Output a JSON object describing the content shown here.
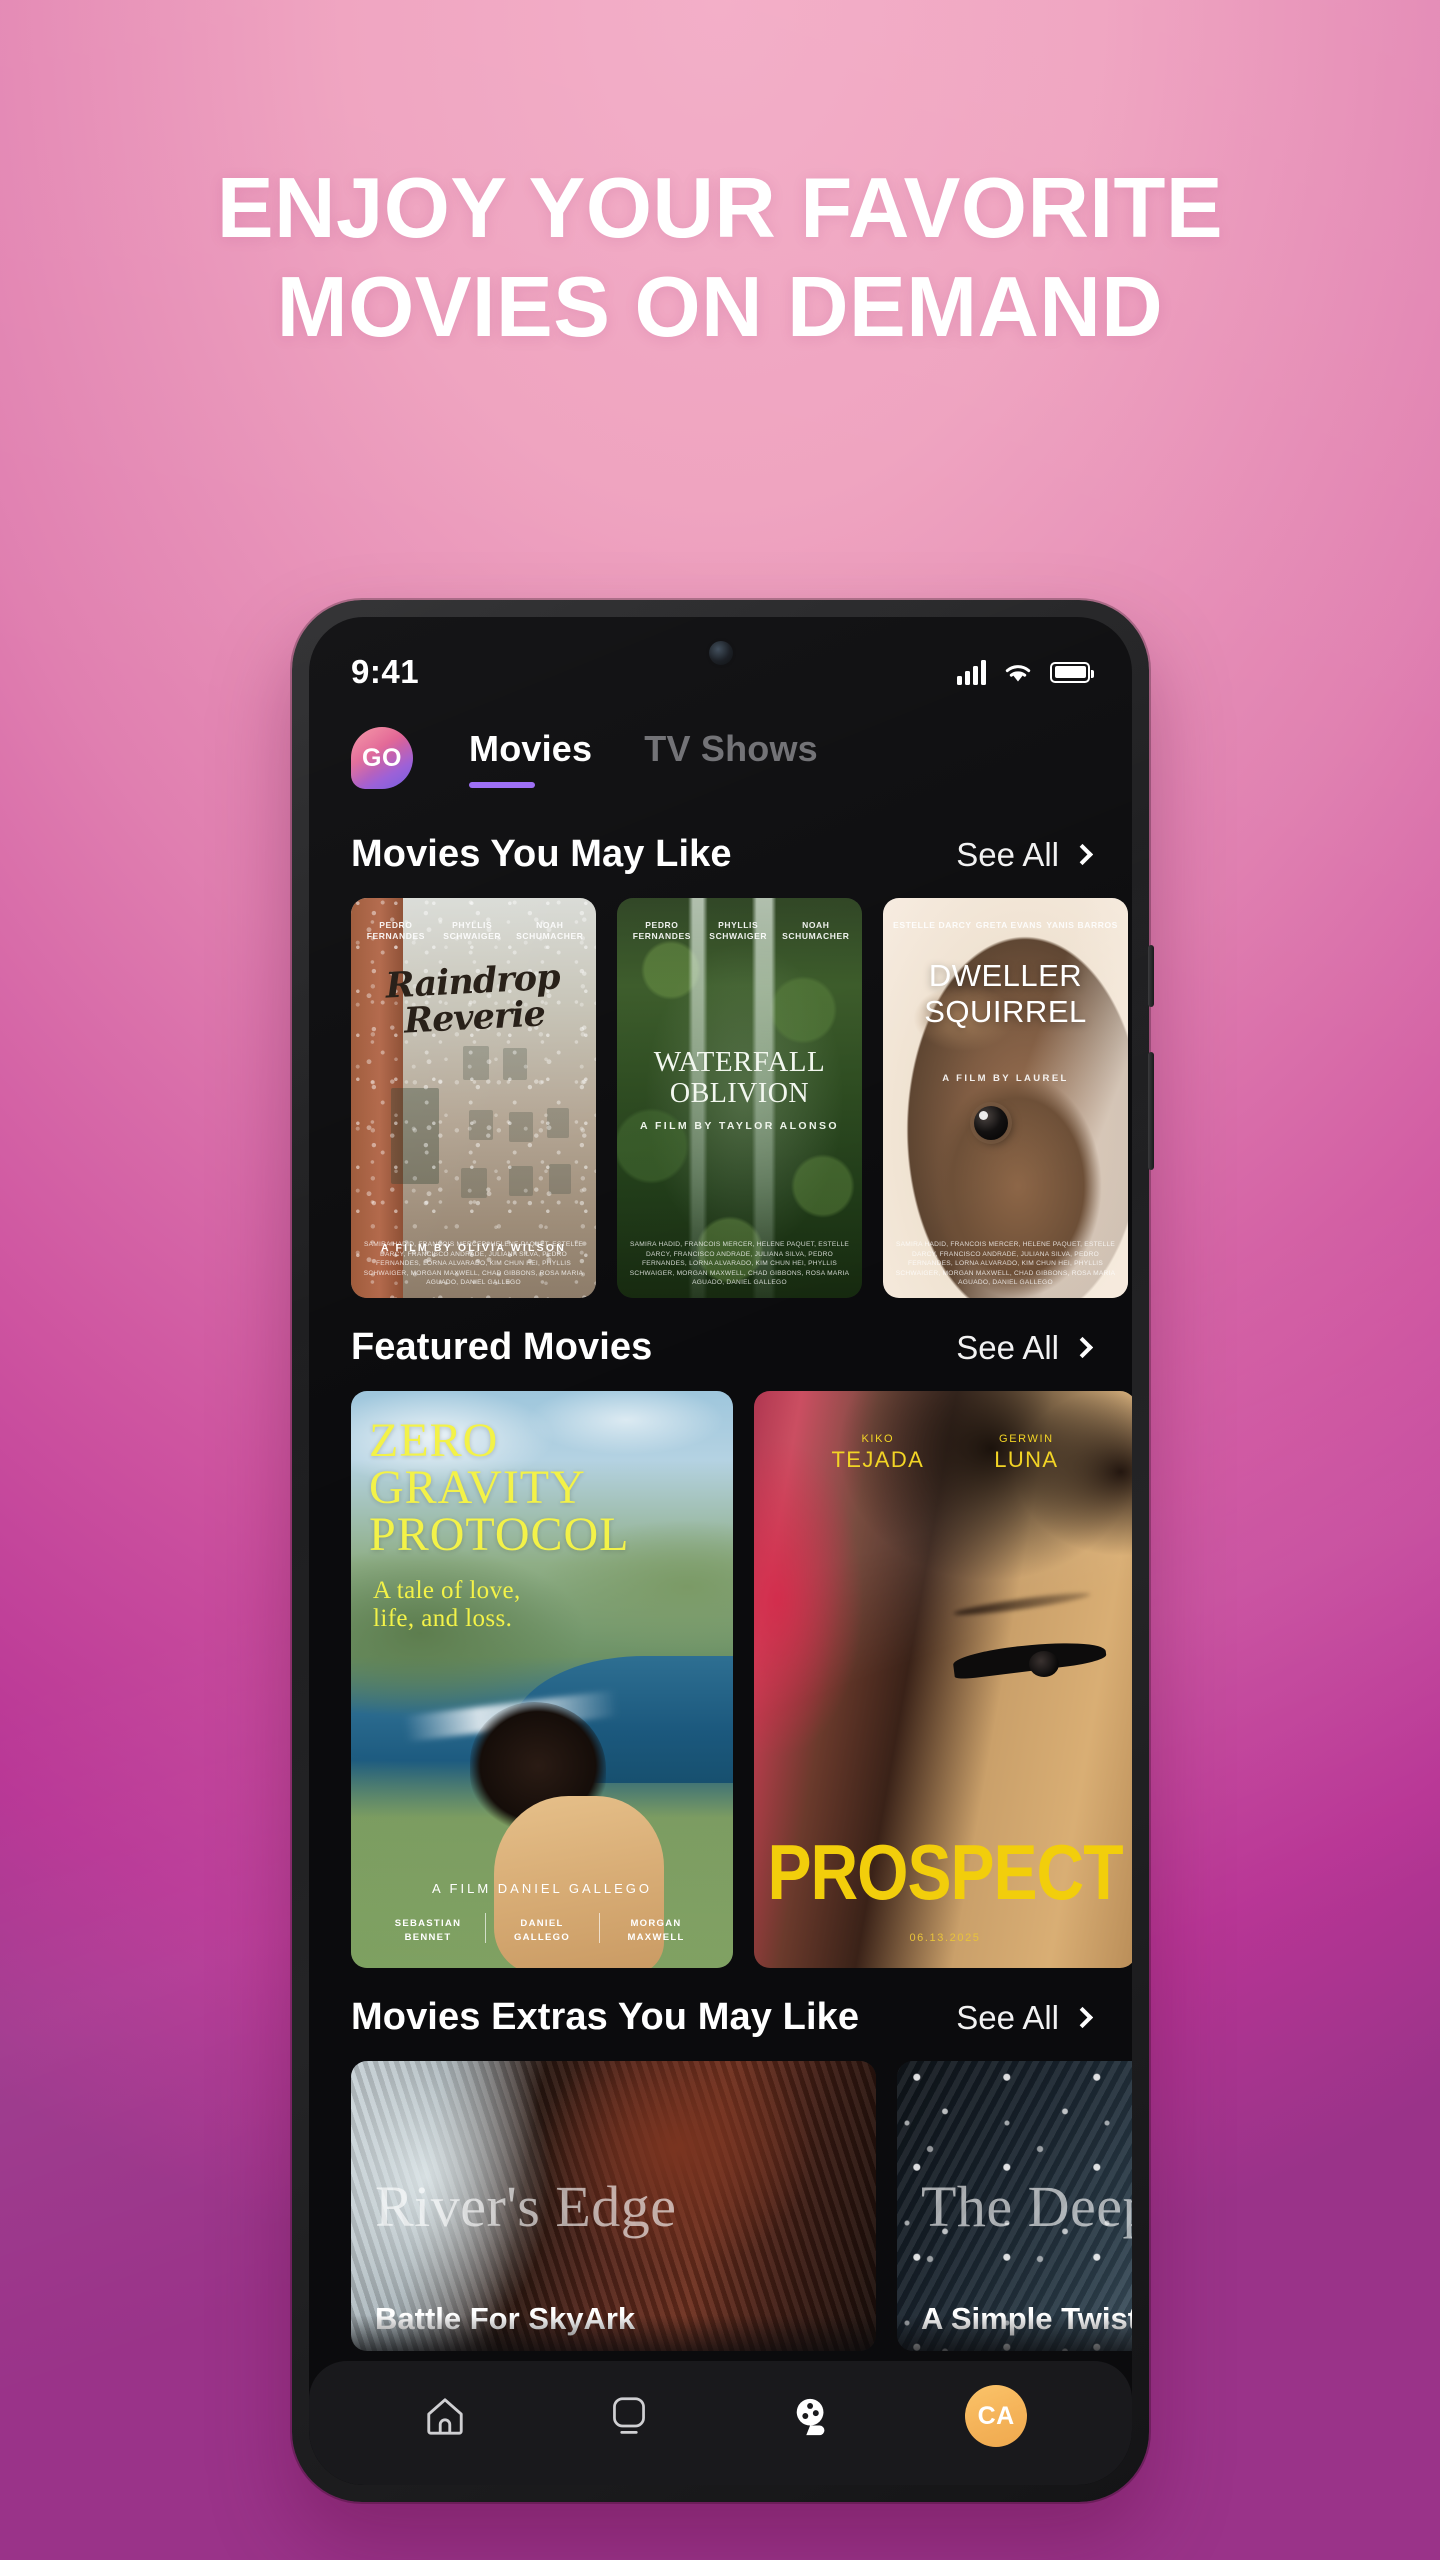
{
  "promo": {
    "headline_line1": "ENJOY YOUR FAVORITE",
    "headline_line2": "MOVIES ON DEMAND",
    "headline_color": "#FFFFFF",
    "background_top_color": "#F0A7C1",
    "background_bottom_left_color": "#C4418F",
    "background_bottom_right_color": "#93338A"
  },
  "status_bar": {
    "time": "9:41",
    "signal_icon": "cellular-signal-icon",
    "wifi_icon": "wifi-icon",
    "battery_icon": "battery-full-icon"
  },
  "app_bar": {
    "logo_text": "GO",
    "tabs": [
      {
        "label": "Movies",
        "active": true
      },
      {
        "label": "TV Shows",
        "active": false
      }
    ],
    "active_indicator_color": "#9B6BF5"
  },
  "sections": [
    {
      "title": "Movies You May Like",
      "see_all_label": "See All",
      "see_all_icon": "chevron-right-icon",
      "items": [
        {
          "title_line1": "Raindrop",
          "title_line2": "Reverie",
          "cast_top": [
            "PEDRO FERNANDES",
            "PHYLLIS SCHWAIGER",
            "NOAH SCHUMACHER"
          ],
          "director": "A FILM BY OLIVIA WILSON",
          "credits": "SAMIRA HADID, FRANCOIS MERCER, HELENE PAQUET, ESTELLE DARCY, FRANCISCO ANDRADE, JULIANA SILVA, PEDRO FERNANDES, LORNA ALVARADO, KIM CHUN HEI, PHYLLIS SCHWAIGER, MORGAN MAXWELL, CHAD GIBBONS, ROSA MARIA AGUADO, DANIEL GALLEGO"
        },
        {
          "title_line1": "WATERFALL",
          "title_line2": "OBLIVION",
          "cast_top": [
            "PEDRO FERNANDES",
            "PHYLLIS SCHWAIGER",
            "NOAH SCHUMACHER"
          ],
          "director": "A FILM BY TAYLOR ALONSO",
          "credits": "SAMIRA HADID, FRANCOIS MERCER, HELENE PAQUET, ESTELLE DARCY, FRANCISCO ANDRADE, JULIANA SILVA, PEDRO FERNANDES, LORNA ALVARADO, KIM CHUN HEI, PHYLLIS SCHWAIGER, MORGAN MAXWELL, CHAD GIBBONS, ROSA MARIA AGUADO, DANIEL GALLEGO"
        },
        {
          "title_line1": "DWELLER",
          "title_line2": "SQUIRREL",
          "cast_top": [
            "ESTELLE DARCY",
            "GRETA EVANS",
            "YANIS BARROS"
          ],
          "director": "A FILM BY LAUREL",
          "credits": "SAMIRA HADID, FRANCOIS MERCER, HELENE PAQUET, ESTELLE DARCY, FRANCISCO ANDRADE, JULIANA SILVA, PEDRO FERNANDES, LORNA ALVARADO, KIM CHUN HEI, PHYLLIS SCHWAIGER, MORGAN MAXWELL, CHAD GIBBONS, ROSA MARIA AGUADO, DANIEL GALLEGO"
        }
      ]
    },
    {
      "title": "Featured Movies",
      "see_all_label": "See All",
      "see_all_icon": "chevron-right-icon",
      "items": [
        {
          "title_line1": "ZERO",
          "title_line2": "GRAVITY",
          "title_line3": "PROTOCOL",
          "tagline_line1": "A tale of love,",
          "tagline_line2": "life, and loss.",
          "director": "A FILM DANIEL GALLEGO",
          "cast": [
            {
              "first": "SEBASTIAN",
              "last": "BENNET"
            },
            {
              "first": "DANIEL",
              "last": "GALLEGO"
            },
            {
              "first": "MORGAN",
              "last": "MAXWELL"
            }
          ],
          "title_color": "#F3F248"
        },
        {
          "title": "PROSPECT",
          "cast": [
            {
              "first": "KIKO",
              "last": "TEJADA"
            },
            {
              "first": "GERWIN",
              "last": "LUNA"
            }
          ],
          "release_date": "06.13.2025",
          "title_color": "#F2CE0B"
        }
      ]
    },
    {
      "title": "Movies Extras You May Like",
      "see_all_label": "See All",
      "see_all_icon": "chevron-right-icon",
      "items": [
        {
          "poster_text": "River's Edge",
          "name": "Battle For SkyArk"
        },
        {
          "poster_text": "The Deep",
          "name": "A Simple Twist of"
        }
      ]
    }
  ],
  "bottom_nav": {
    "items": [
      {
        "icon": "home-icon",
        "label": "Home"
      },
      {
        "icon": "tv-icon",
        "label": "TV"
      },
      {
        "icon": "film-reel-icon",
        "label": "Movies"
      }
    ],
    "avatar_initials": "CA",
    "avatar_color": "#F5B45A"
  }
}
